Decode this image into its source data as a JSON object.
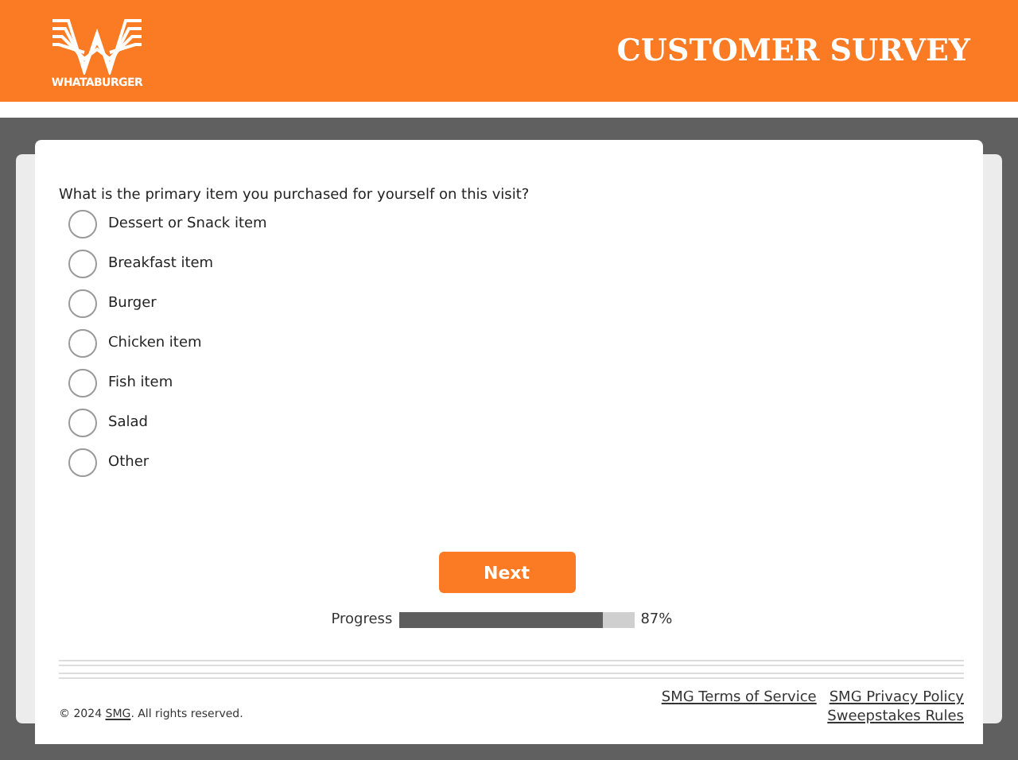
{
  "header": {
    "logo_text": "WHATABURGER",
    "title": "CUSTOMER SURVEY"
  },
  "question": {
    "text": "What is the primary item you purchased for yourself on this visit?",
    "options": [
      {
        "label": "Dessert or Snack item",
        "selected": false
      },
      {
        "label": "Breakfast item",
        "selected": false
      },
      {
        "label": "Burger",
        "selected": false
      },
      {
        "label": "Chicken item",
        "selected": false
      },
      {
        "label": "Fish item",
        "selected": false
      },
      {
        "label": "Salad",
        "selected": false
      },
      {
        "label": "Other",
        "selected": false
      }
    ]
  },
  "next_button": "Next",
  "progress": {
    "label": "Progress",
    "level": 0.87,
    "reading": "87%"
  },
  "footer": {
    "links": [
      "SMG Terms of Service",
      "SMG Privacy Policy",
      "Sweepstakes Rules"
    ],
    "copyright": {
      "before": "© 2024 ",
      "link": "SMG",
      "after": ". All rights reserved."
    }
  }
}
